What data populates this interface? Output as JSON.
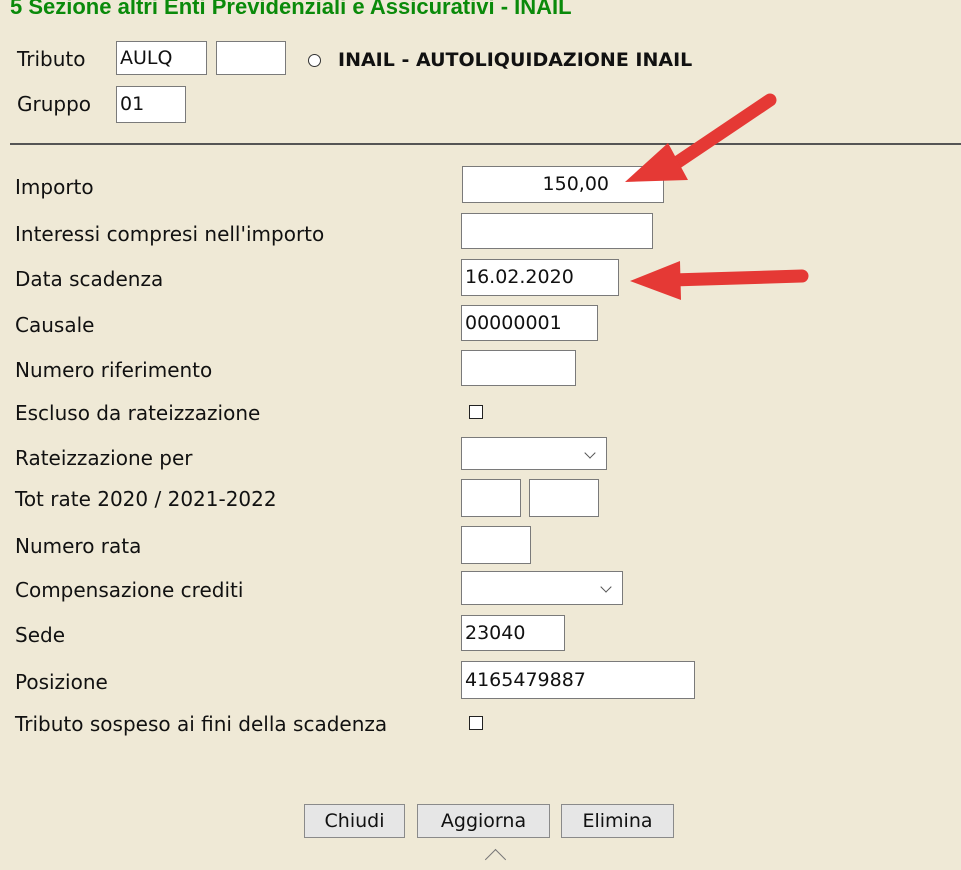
{
  "section": {
    "title": "5 Sezione altri Enti Previdenziali e Assicurativi - INAIL"
  },
  "header": {
    "tributo_label": "Tributo",
    "tributo_value": "AULQ",
    "tributo_extra": "",
    "inail_label": "INAIL - AUTOLIQUIDAZIONE INAIL",
    "gruppo_label": "Gruppo",
    "gruppo_value": "01"
  },
  "fields": {
    "importo": {
      "label": "Importo",
      "value": "150,00"
    },
    "interessi": {
      "label": "Interessi compresi nell'importo",
      "value": ""
    },
    "data_scadenza": {
      "label": "Data scadenza",
      "value": "16.02.2020"
    },
    "causale": {
      "label": "Causale",
      "value": "00000001"
    },
    "numero_riferimento": {
      "label": "Numero riferimento",
      "value": ""
    },
    "escluso_rateizzazione": {
      "label": "Escluso da rateizzazione",
      "checked": false
    },
    "rateizzazione_per": {
      "label": "Rateizzazione per",
      "value": ""
    },
    "tot_rate": {
      "label": "Tot rate 2020 / 2021-2022",
      "value_a": "",
      "value_b": ""
    },
    "numero_rata": {
      "label": "Numero rata",
      "value": ""
    },
    "compensazione_crediti": {
      "label": "Compensazione crediti",
      "value": ""
    },
    "sede": {
      "label": "Sede",
      "value": "23040"
    },
    "posizione": {
      "label": "Posizione",
      "value": "4165479887"
    },
    "tributo_sospeso": {
      "label": "Tributo sospeso ai fini della scadenza",
      "checked": false
    }
  },
  "buttons": {
    "chiudi": "Chiudi",
    "aggiorna": "Aggiorna",
    "elimina": "Elimina"
  },
  "colors": {
    "background": "#efe9d6",
    "title_green": "#0a8a0a",
    "arrow_red": "#e53935"
  }
}
